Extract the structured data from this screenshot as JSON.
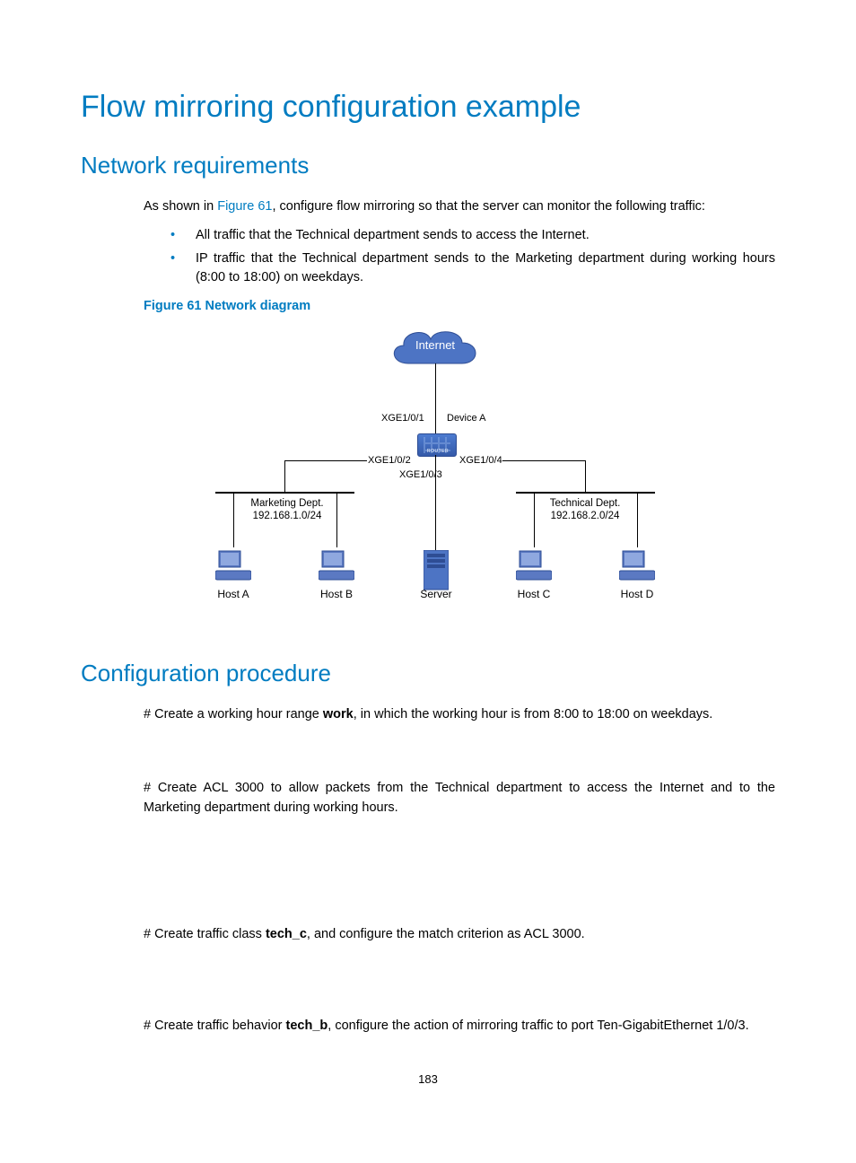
{
  "title": "Flow mirroring configuration example",
  "section_network": "Network requirements",
  "intro_before": "As shown in ",
  "intro_link": "Figure 61",
  "intro_after": ", configure flow mirroring so that the server can monitor the following traffic:",
  "bullets": [
    "All traffic that the Technical department sends to access the Internet.",
    "IP traffic that the Technical department sends to the Marketing department during working hours (8:00 to 18:00) on weekdays."
  ],
  "figure_caption": "Figure 61 Network diagram",
  "diagram": {
    "internet": "Internet",
    "device_a": "Device A",
    "port1": "XGE1/0/1",
    "port2": "XGE1/0/2",
    "port3": "XGE1/0/3",
    "port4": "XGE1/0/4",
    "marketing_dept": "Marketing Dept.",
    "marketing_net": "192.168.1.0/24",
    "technical_dept": "Technical Dept.",
    "technical_net": "192.168.2.0/24",
    "host_a": "Host A",
    "host_b": "Host B",
    "server": "Server",
    "host_c": "Host C",
    "host_d": "Host D"
  },
  "section_config": "Configuration procedure",
  "step1_before": "# Create a working hour range ",
  "step1_bold": "work",
  "step1_after": ", in which the working hour is from 8:00 to 18:00 on weekdays.",
  "step2": "# Create ACL 3000 to allow packets from the Technical department to access the Internet and to the Marketing department during working hours.",
  "step3_before": "# Create traffic class ",
  "step3_bold": "tech_c",
  "step3_after": ", and configure the match criterion as ACL 3000.",
  "step4_before": "# Create traffic behavior ",
  "step4_bold": "tech_b",
  "step4_after": ", configure the action of mirroring traffic to port Ten-GigabitEthernet 1/0/3.",
  "page_number": "183"
}
